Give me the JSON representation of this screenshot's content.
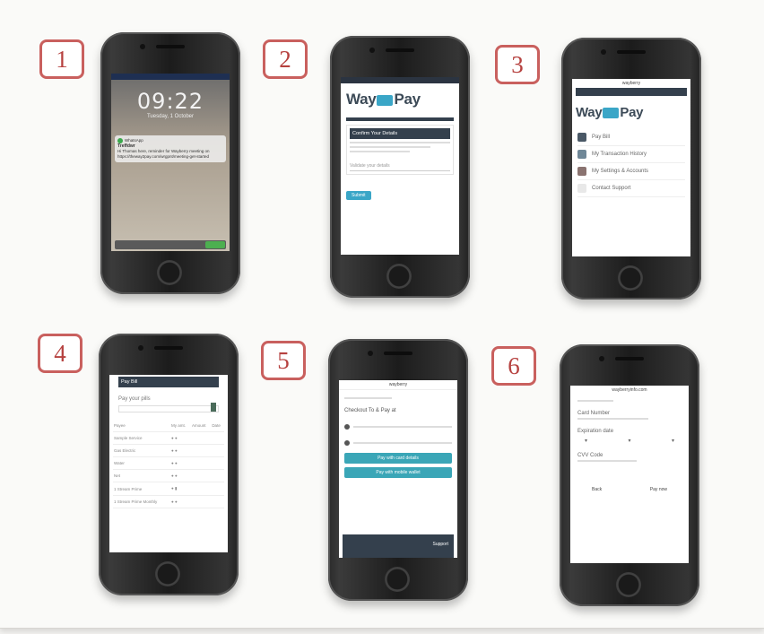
{
  "badges": [
    "1",
    "2",
    "3",
    "4",
    "5",
    "6"
  ],
  "phone1": {
    "time": "09:22",
    "date": "Tuesday, 1 October",
    "app": "WhatsApp",
    "sender": "Treffdwr",
    "message": "Hi Thomas here, reminder for Wayberry meeting on https://theway2pay.com/wrgpnt/meeting-get-started"
  },
  "phone2": {
    "logo_left": "Way",
    "logo_right": "Pay",
    "header": "Confirm Your Details",
    "field": "Validate your details",
    "button": "Submit"
  },
  "phone3": {
    "url": "wayberry",
    "logo_left": "Way",
    "logo_right": "Pay",
    "menu": [
      "Pay Bill",
      "My Transaction History",
      "My Settings & Accounts",
      "Contact Support"
    ]
  },
  "phone4": {
    "header": "Pay Bill",
    "amount_label": "Pay your pills",
    "columns": [
      "Payee",
      "My amt.",
      "Amount",
      "Date"
    ],
    "rows": [
      "Sample Service",
      "Gas Electric",
      "Water",
      "Net",
      "1 Stream Prime",
      "1 Stream Prime Monthly"
    ]
  },
  "phone5": {
    "url": "wayberry",
    "title": "Checkout To & Pay at",
    "btn1": "Pay with card details",
    "btn2": "Pay with mobile wallet",
    "footer": "Support"
  },
  "phone6": {
    "url": "wayberryinfo.com",
    "fields": [
      "Card Number",
      "Expiration date",
      "CVV Code"
    ],
    "actions": [
      "Back",
      "Pay now"
    ]
  }
}
